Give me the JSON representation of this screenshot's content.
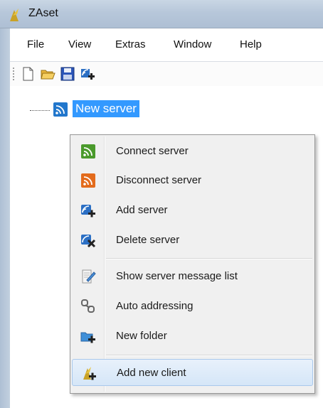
{
  "window": {
    "title": "ZAset"
  },
  "menubar": {
    "items": [
      "File",
      "View",
      "Extras",
      "Window",
      "Help"
    ]
  },
  "toolbar": {
    "buttons": [
      "new-document-icon",
      "open-folder-icon",
      "save-icon",
      "add-server-icon"
    ]
  },
  "tree": {
    "root_label": "New server"
  },
  "context_menu": {
    "items": [
      {
        "label": "Connect server",
        "icon": "connect-server-icon"
      },
      {
        "label": "Disconnect server",
        "icon": "disconnect-server-icon"
      },
      {
        "label": "Add server",
        "icon": "add-server-icon"
      },
      {
        "label": "Delete server",
        "icon": "delete-server-icon"
      },
      {
        "label": "Show server message list",
        "icon": "message-list-icon"
      },
      {
        "label": "Auto addressing",
        "icon": "auto-addressing-icon"
      },
      {
        "label": "New folder",
        "icon": "new-folder-icon"
      },
      {
        "label": "Add new client",
        "icon": "add-client-icon"
      }
    ],
    "highlighted_index": 7
  },
  "colors": {
    "selection": "#3399ff",
    "highlight_border": "#a9c8ec",
    "menu_bg": "#f0f0f0"
  }
}
